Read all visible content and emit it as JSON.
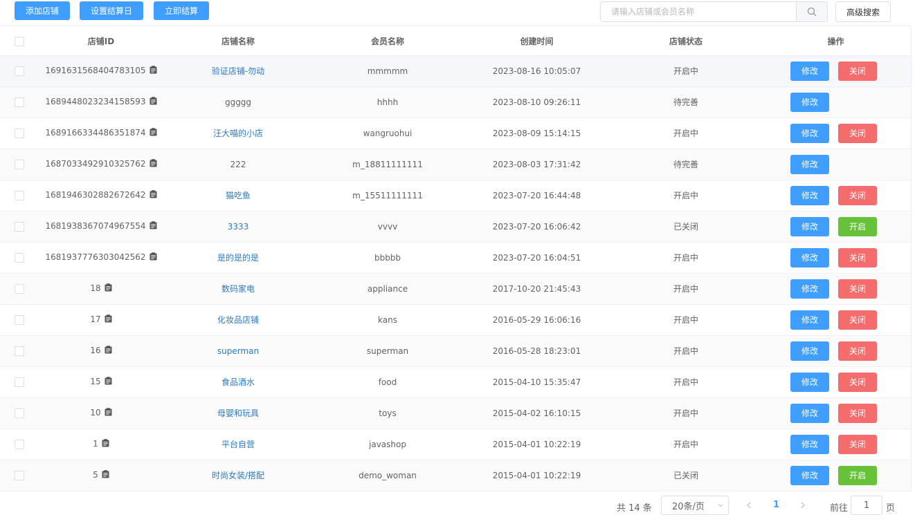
{
  "toolbar": {
    "add_shop": "添加店铺",
    "set_settle_day": "设置结算日",
    "settle_now": "立即结算",
    "search_placeholder": "请输入店铺或会员名称",
    "advanced_search": "高级搜索"
  },
  "table": {
    "headers": [
      "店铺ID",
      "店铺名称",
      "会员名称",
      "创建时间",
      "店铺状态",
      "操作"
    ],
    "edit_label": "修改",
    "rows": [
      {
        "id": "1691631568404783105",
        "name": "验证店铺-勿动",
        "member": "mmmmm",
        "created": "2023-08-16 10:05:07",
        "status": "开启中",
        "action": "关闭"
      },
      {
        "id": "1689448023234158593",
        "name": "ggggg",
        "member": "hhhh",
        "created": "2023-08-10 09:26:11",
        "status": "待完善",
        "action": ""
      },
      {
        "id": "1689166334486351874",
        "name": "汪大喵的小店",
        "member": "wangruohui",
        "created": "2023-08-09 15:14:15",
        "status": "开启中",
        "action": "关闭"
      },
      {
        "id": "1687033492910325762",
        "name": "222",
        "member": "m_18811111111",
        "created": "2023-08-03 17:31:42",
        "status": "待完善",
        "action": ""
      },
      {
        "id": "1681946302882672642",
        "name": "猫吃鱼",
        "member": "m_15511111111",
        "created": "2023-07-20 16:44:48",
        "status": "开启中",
        "action": "关闭"
      },
      {
        "id": "1681938367074967554",
        "name": "3333",
        "member": "vvvv",
        "created": "2023-07-20 16:06:42",
        "status": "已关闭",
        "action": "开启"
      },
      {
        "id": "1681937776303042562",
        "name": "是的是的是",
        "member": "bbbbb",
        "created": "2023-07-20 16:04:51",
        "status": "开启中",
        "action": "关闭"
      },
      {
        "id": "18",
        "name": "数码家电",
        "member": "appliance",
        "created": "2017-10-20 21:45:43",
        "status": "开启中",
        "action": "关闭"
      },
      {
        "id": "17",
        "name": "化妆品店铺",
        "member": "kans",
        "created": "2016-05-29 16:06:16",
        "status": "开启中",
        "action": "关闭"
      },
      {
        "id": "16",
        "name": "superman",
        "member": "superman",
        "created": "2016-05-28 18:23:01",
        "status": "开启中",
        "action": "关闭"
      },
      {
        "id": "15",
        "name": "食品酒水",
        "member": "food",
        "created": "2015-04-10 15:35:47",
        "status": "开启中",
        "action": "关闭"
      },
      {
        "id": "10",
        "name": "母婴和玩具",
        "member": "toys",
        "created": "2015-04-02 16:10:15",
        "status": "开启中",
        "action": "关闭"
      },
      {
        "id": "1",
        "name": "平台自营",
        "member": "javashop",
        "created": "2015-04-01 10:22:19",
        "status": "开启中",
        "action": "关闭"
      },
      {
        "id": "5",
        "name": "时尚女装/搭配",
        "member": "demo_woman",
        "created": "2015-04-01 10:22:19",
        "status": "已关闭",
        "action": "开启"
      }
    ]
  },
  "pagination": {
    "total": "共 14 条",
    "page_size": "20条/页",
    "current_page": "1",
    "goto_label": "前往",
    "goto_value": "1",
    "page_unit": "页"
  },
  "colors": {
    "primary": "#409eff",
    "danger": "#f56c6c",
    "success": "#67c23a",
    "link": "#2b79c2"
  },
  "icons": {
    "search": "search-icon",
    "copy": "clipboard-icon",
    "prev": "chevron-left-icon",
    "next": "chevron-right-icon",
    "dropdown": "chevron-down-icon"
  }
}
